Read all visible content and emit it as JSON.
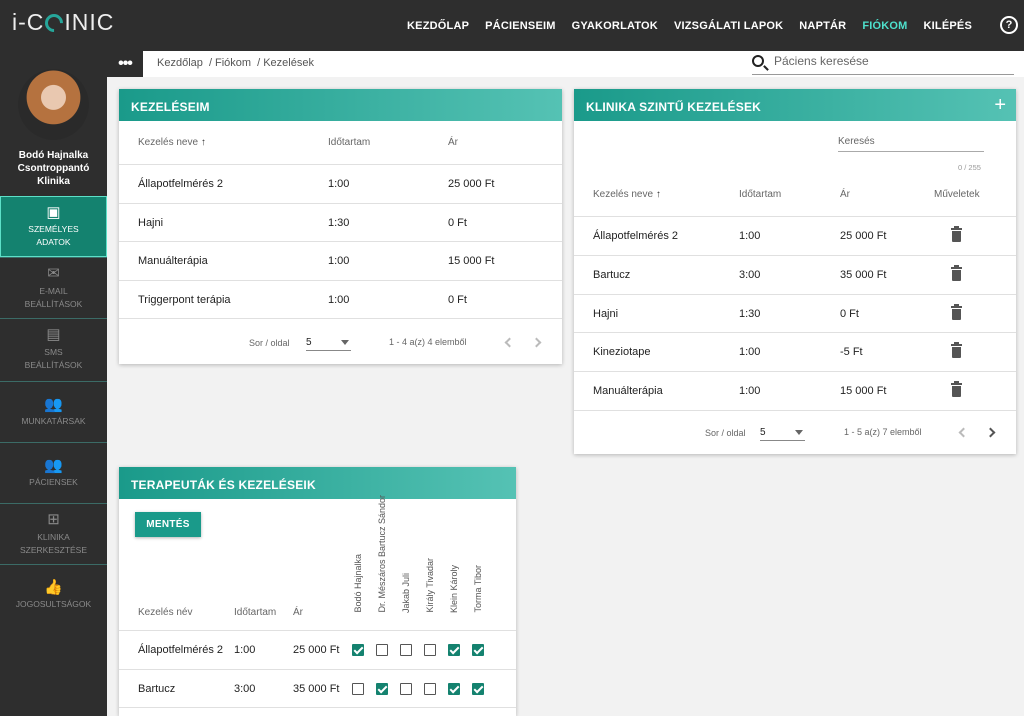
{
  "app": {
    "logo_prefix": "i-C",
    "logo_suffix": "INIC"
  },
  "topnav": [
    {
      "label": "KEZDŐLAP",
      "active": false
    },
    {
      "label": "PÁCIENSEIM",
      "active": false
    },
    {
      "label": "GYAKORLATOK",
      "active": false
    },
    {
      "label": "VIZSGÁLATI LAPOK",
      "active": false
    },
    {
      "label": "NAPTÁR",
      "active": false
    },
    {
      "label": "FIÓKOM",
      "active": true
    },
    {
      "label": "KILÉPÉS",
      "active": false
    }
  ],
  "help_label": "?",
  "user": {
    "name_line1": "Bodó Hajnalka",
    "name_line2": "Csontroppantó",
    "name_line3": "Klinika"
  },
  "sidebar": [
    {
      "line1": "SZEMÉLYES",
      "line2": "ADATOK",
      "icon": "person-icon",
      "active": true
    },
    {
      "line1": "E-MAIL",
      "line2": "BEÁLLÍTÁSOK",
      "icon": "mail-icon",
      "active": false
    },
    {
      "line1": "SMS",
      "line2": "BEÁLLÍTÁSOK",
      "icon": "sms-icon",
      "active": false
    },
    {
      "line1": "MUNKATÁRSAK",
      "line2": "",
      "icon": "group-icon",
      "active": false
    },
    {
      "line1": "PÁCIENSEK",
      "line2": "",
      "icon": "group-icon",
      "active": false
    },
    {
      "line1": "KLINIKA",
      "line2": "SZERKESZTÉSE",
      "icon": "plus-box-icon",
      "active": false
    },
    {
      "line1": "JOGOSULTSÁGOK",
      "line2": "",
      "icon": "thumb-up-icon",
      "active": false
    }
  ],
  "breadcrumb": {
    "dots": "•••",
    "items": [
      "Kezdőlap",
      "Fiókom",
      "Kezelések"
    ],
    "sep": "/"
  },
  "search": {
    "placeholder": "Páciens keresése"
  },
  "my_treatments": {
    "title": "KEZELÉSEIM",
    "headers": {
      "name": "Kezelés neve",
      "duration": "Időtartam",
      "price": "Ár"
    },
    "rows": [
      {
        "name": "Állapotfelmérés 2",
        "duration": "1:00",
        "price": "25 000 Ft"
      },
      {
        "name": "Hajni",
        "duration": "1:30",
        "price": "0 Ft"
      },
      {
        "name": "Manuálterápia",
        "duration": "1:00",
        "price": "15 000 Ft"
      },
      {
        "name": "Triggerpont terápia",
        "duration": "1:00",
        "price": "0 Ft"
      }
    ],
    "pager": {
      "rows_label": "Sor / oldal",
      "rows_value": "5",
      "range": "1 - 4 a(z) 4 elemből"
    }
  },
  "clinic_treatments": {
    "title": "KLINIKA SZINTŰ KEZELÉSEK",
    "add": "+",
    "search_label": "Keresés",
    "counter": "0 / 255",
    "headers": {
      "name": "Kezelés neve",
      "duration": "Időtartam",
      "price": "Ár",
      "actions": "Műveletek"
    },
    "rows": [
      {
        "name": "Állapotfelmérés 2",
        "duration": "1:00",
        "price": "25 000 Ft"
      },
      {
        "name": "Bartucz",
        "duration": "3:00",
        "price": "35 000 Ft"
      },
      {
        "name": "Hajni",
        "duration": "1:30",
        "price": "0 Ft"
      },
      {
        "name": "Kineziotape",
        "duration": "1:00",
        "price": "-5 Ft"
      },
      {
        "name": "Manuálterápia",
        "duration": "1:00",
        "price": "15 000 Ft"
      }
    ],
    "pager": {
      "rows_label": "Sor / oldal",
      "rows_value": "5",
      "range": "1 - 5 a(z) 7 elemből"
    }
  },
  "therapists": {
    "title": "TERAPEUTÁK ÉS KEZELÉSEIK",
    "save": "MENTÉS",
    "headers": {
      "name": "Kezelés név",
      "duration": "Időtartam",
      "price": "Ár"
    },
    "columns": [
      "Bodó Hajnalka",
      "Dr. Mészáros Bartucz Sándor",
      "Jakab Juli",
      "Király Tivadar",
      "Klein Károly",
      "Torma Tibor"
    ],
    "rows": [
      {
        "name": "Állapotfelmérés 2",
        "duration": "1:00",
        "price": "25 000 Ft",
        "checks": [
          true,
          false,
          false,
          false,
          true,
          true
        ]
      },
      {
        "name": "Bartucz",
        "duration": "3:00",
        "price": "35 000 Ft",
        "checks": [
          false,
          true,
          false,
          false,
          true,
          true
        ]
      }
    ]
  }
}
